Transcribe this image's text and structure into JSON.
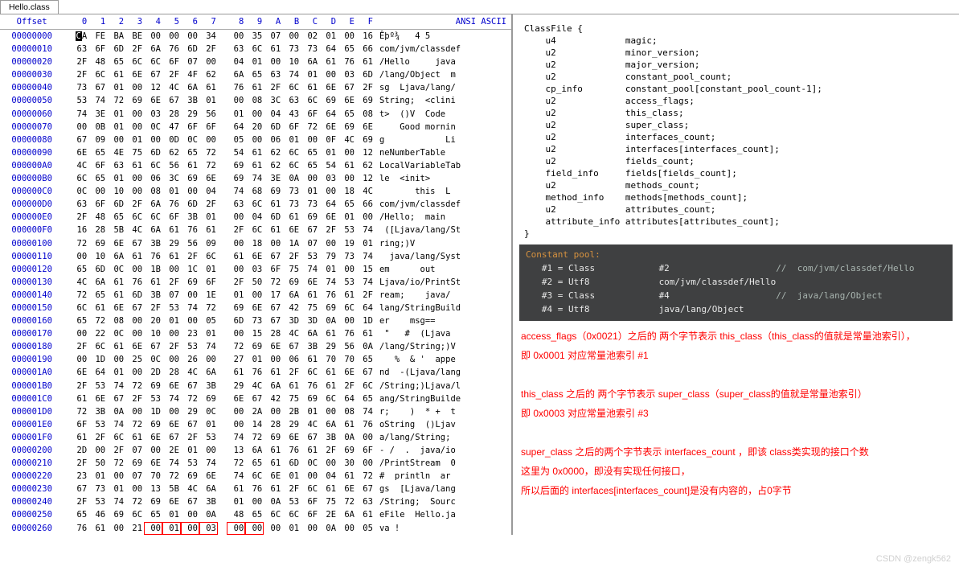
{
  "tab": "Hello.class",
  "headers": {
    "offset": "Offset",
    "hex": [
      "0",
      "1",
      "2",
      "3",
      "4",
      "5",
      "6",
      "7",
      "8",
      "9",
      "A",
      "B",
      "C",
      "D",
      "E",
      "F"
    ],
    "ascii": "ANSI ASCII"
  },
  "rows": [
    {
      "o": "00000000",
      "h": [
        "CA",
        "FE",
        "BA",
        "BE",
        "00",
        "00",
        "00",
        "34",
        "00",
        "35",
        "07",
        "00",
        "02",
        "01",
        "00",
        "16"
      ],
      "a": "Êþº¾   4 5    "
    },
    {
      "o": "00000010",
      "h": [
        "63",
        "6F",
        "6D",
        "2F",
        "6A",
        "76",
        "6D",
        "2F",
        "63",
        "6C",
        "61",
        "73",
        "73",
        "64",
        "65",
        "66"
      ],
      "a": "com/jvm/classdef"
    },
    {
      "o": "00000020",
      "h": [
        "2F",
        "48",
        "65",
        "6C",
        "6C",
        "6F",
        "07",
        "00",
        "04",
        "01",
        "00",
        "10",
        "6A",
        "61",
        "76",
        "61"
      ],
      "a": "/Hello     java"
    },
    {
      "o": "00000030",
      "h": [
        "2F",
        "6C",
        "61",
        "6E",
        "67",
        "2F",
        "4F",
        "62",
        "6A",
        "65",
        "63",
        "74",
        "01",
        "00",
        "03",
        "6D"
      ],
      "a": "/lang/Object  m"
    },
    {
      "o": "00000040",
      "h": [
        "73",
        "67",
        "01",
        "00",
        "12",
        "4C",
        "6A",
        "61",
        "76",
        "61",
        "2F",
        "6C",
        "61",
        "6E",
        "67",
        "2F"
      ],
      "a": "sg  Ljava/lang/"
    },
    {
      "o": "00000050",
      "h": [
        "53",
        "74",
        "72",
        "69",
        "6E",
        "67",
        "3B",
        "01",
        "00",
        "08",
        "3C",
        "63",
        "6C",
        "69",
        "6E",
        "69"
      ],
      "a": "String;  <clini"
    },
    {
      "o": "00000060",
      "h": [
        "74",
        "3E",
        "01",
        "00",
        "03",
        "28",
        "29",
        "56",
        "01",
        "00",
        "04",
        "43",
        "6F",
        "64",
        "65",
        "08"
      ],
      "a": "t>  ()V  Code "
    },
    {
      "o": "00000070",
      "h": [
        "00",
        "0B",
        "01",
        "00",
        "0C",
        "47",
        "6F",
        "6F",
        "64",
        "20",
        "6D",
        "6F",
        "72",
        "6E",
        "69",
        "6E"
      ],
      "a": "    Good mornin"
    },
    {
      "o": "00000080",
      "h": [
        "67",
        "09",
        "00",
        "01",
        "00",
        "0D",
        "0C",
        "00",
        "05",
        "00",
        "06",
        "01",
        "00",
        "0F",
        "4C",
        "69"
      ],
      "a": "g            Li"
    },
    {
      "o": "00000090",
      "h": [
        "6E",
        "65",
        "4E",
        "75",
        "6D",
        "62",
        "65",
        "72",
        "54",
        "61",
        "62",
        "6C",
        "65",
        "01",
        "00",
        "12"
      ],
      "a": "neNumberTable   "
    },
    {
      "o": "000000A0",
      "h": [
        "4C",
        "6F",
        "63",
        "61",
        "6C",
        "56",
        "61",
        "72",
        "69",
        "61",
        "62",
        "6C",
        "65",
        "54",
        "61",
        "62"
      ],
      "a": "LocalVariableTab"
    },
    {
      "o": "000000B0",
      "h": [
        "6C",
        "65",
        "01",
        "00",
        "06",
        "3C",
        "69",
        "6E",
        "69",
        "74",
        "3E",
        "0A",
        "00",
        "03",
        "00",
        "12"
      ],
      "a": "le  <init>     "
    },
    {
      "o": "000000C0",
      "h": [
        "0C",
        "00",
        "10",
        "00",
        "08",
        "01",
        "00",
        "04",
        "74",
        "68",
        "69",
        "73",
        "01",
        "00",
        "18",
        "4C"
      ],
      "a": "       this  L"
    },
    {
      "o": "000000D0",
      "h": [
        "63",
        "6F",
        "6D",
        "2F",
        "6A",
        "76",
        "6D",
        "2F",
        "63",
        "6C",
        "61",
        "73",
        "73",
        "64",
        "65",
        "66"
      ],
      "a": "com/jvm/classdef"
    },
    {
      "o": "000000E0",
      "h": [
        "2F",
        "48",
        "65",
        "6C",
        "6C",
        "6F",
        "3B",
        "01",
        "00",
        "04",
        "6D",
        "61",
        "69",
        "6E",
        "01",
        "00"
      ],
      "a": "/Hello;  main  "
    },
    {
      "o": "000000F0",
      "h": [
        "16",
        "28",
        "5B",
        "4C",
        "6A",
        "61",
        "76",
        "61",
        "2F",
        "6C",
        "61",
        "6E",
        "67",
        "2F",
        "53",
        "74"
      ],
      "a": " ([Ljava/lang/St"
    },
    {
      "o": "00000100",
      "h": [
        "72",
        "69",
        "6E",
        "67",
        "3B",
        "29",
        "56",
        "09",
        "00",
        "18",
        "00",
        "1A",
        "07",
        "00",
        "19",
        "01"
      ],
      "a": "ring;)V        "
    },
    {
      "o": "00000110",
      "h": [
        "00",
        "10",
        "6A",
        "61",
        "76",
        "61",
        "2F",
        "6C",
        "61",
        "6E",
        "67",
        "2F",
        "53",
        "79",
        "73",
        "74"
      ],
      "a": "  java/lang/Syst"
    },
    {
      "o": "00000120",
      "h": [
        "65",
        "6D",
        "0C",
        "00",
        "1B",
        "00",
        "1C",
        "01",
        "00",
        "03",
        "6F",
        "75",
        "74",
        "01",
        "00",
        "15"
      ],
      "a": "em      out   "
    },
    {
      "o": "00000130",
      "h": [
        "4C",
        "6A",
        "61",
        "76",
        "61",
        "2F",
        "69",
        "6F",
        "2F",
        "50",
        "72",
        "69",
        "6E",
        "74",
        "53",
        "74"
      ],
      "a": "Ljava/io/PrintSt"
    },
    {
      "o": "00000140",
      "h": [
        "72",
        "65",
        "61",
        "6D",
        "3B",
        "07",
        "00",
        "1E",
        "01",
        "00",
        "17",
        "6A",
        "61",
        "76",
        "61",
        "2F"
      ],
      "a": "ream;    java/"
    },
    {
      "o": "00000150",
      "h": [
        "6C",
        "61",
        "6E",
        "67",
        "2F",
        "53",
        "74",
        "72",
        "69",
        "6E",
        "67",
        "42",
        "75",
        "69",
        "6C",
        "64"
      ],
      "a": "lang/StringBuild"
    },
    {
      "o": "00000160",
      "h": [
        "65",
        "72",
        "08",
        "00",
        "20",
        "01",
        "00",
        "05",
        "6D",
        "73",
        "67",
        "3D",
        "3D",
        "0A",
        "00",
        "1D"
      ],
      "a": "er    msg==   "
    },
    {
      "o": "00000170",
      "h": [
        "00",
        "22",
        "0C",
        "00",
        "10",
        "00",
        "23",
        "01",
        "00",
        "15",
        "28",
        "4C",
        "6A",
        "61",
        "76",
        "61"
      ],
      "a": " \"   #  (Ljava"
    },
    {
      "o": "00000180",
      "h": [
        "2F",
        "6C",
        "61",
        "6E",
        "67",
        "2F",
        "53",
        "74",
        "72",
        "69",
        "6E",
        "67",
        "3B",
        "29",
        "56",
        "0A"
      ],
      "a": "/lang/String;)V "
    },
    {
      "o": "00000190",
      "h": [
        "00",
        "1D",
        "00",
        "25",
        "0C",
        "00",
        "26",
        "00",
        "27",
        "01",
        "00",
        "06",
        "61",
        "70",
        "70",
        "65"
      ],
      "a": "   %  & '  appe"
    },
    {
      "o": "000001A0",
      "h": [
        "6E",
        "64",
        "01",
        "00",
        "2D",
        "28",
        "4C",
        "6A",
        "61",
        "76",
        "61",
        "2F",
        "6C",
        "61",
        "6E",
        "67"
      ],
      "a": "nd  -(Ljava/lang"
    },
    {
      "o": "000001B0",
      "h": [
        "2F",
        "53",
        "74",
        "72",
        "69",
        "6E",
        "67",
        "3B",
        "29",
        "4C",
        "6A",
        "61",
        "76",
        "61",
        "2F",
        "6C"
      ],
      "a": "/String;)Ljava/l"
    },
    {
      "o": "000001C0",
      "h": [
        "61",
        "6E",
        "67",
        "2F",
        "53",
        "74",
        "72",
        "69",
        "6E",
        "67",
        "42",
        "75",
        "69",
        "6C",
        "64",
        "65"
      ],
      "a": "ang/StringBuilde"
    },
    {
      "o": "000001D0",
      "h": [
        "72",
        "3B",
        "0A",
        "00",
        "1D",
        "00",
        "29",
        "0C",
        "00",
        "2A",
        "00",
        "2B",
        "01",
        "00",
        "08",
        "74"
      ],
      "a": "r;    )  * +  t"
    },
    {
      "o": "000001E0",
      "h": [
        "6F",
        "53",
        "74",
        "72",
        "69",
        "6E",
        "67",
        "01",
        "00",
        "14",
        "28",
        "29",
        "4C",
        "6A",
        "61",
        "76"
      ],
      "a": "oString  ()Ljav"
    },
    {
      "o": "000001F0",
      "h": [
        "61",
        "2F",
        "6C",
        "61",
        "6E",
        "67",
        "2F",
        "53",
        "74",
        "72",
        "69",
        "6E",
        "67",
        "3B",
        "0A",
        "00"
      ],
      "a": "a/lang/String;  "
    },
    {
      "o": "00000200",
      "h": [
        "2D",
        "00",
        "2F",
        "07",
        "00",
        "2E",
        "01",
        "00",
        "13",
        "6A",
        "61",
        "76",
        "61",
        "2F",
        "69",
        "6F"
      ],
      "a": "- /  .  java/io"
    },
    {
      "o": "00000210",
      "h": [
        "2F",
        "50",
        "72",
        "69",
        "6E",
        "74",
        "53",
        "74",
        "72",
        "65",
        "61",
        "6D",
        "0C",
        "00",
        "30",
        "00"
      ],
      "a": "/PrintStream  0 "
    },
    {
      "o": "00000220",
      "h": [
        "23",
        "01",
        "00",
        "07",
        "70",
        "72",
        "69",
        "6E",
        "74",
        "6C",
        "6E",
        "01",
        "00",
        "04",
        "61",
        "72"
      ],
      "a": "#  println  ar"
    },
    {
      "o": "00000230",
      "h": [
        "67",
        "73",
        "01",
        "00",
        "13",
        "5B",
        "4C",
        "6A",
        "61",
        "76",
        "61",
        "2F",
        "6C",
        "61",
        "6E",
        "67"
      ],
      "a": "gs  [Ljava/lang"
    },
    {
      "o": "00000240",
      "h": [
        "2F",
        "53",
        "74",
        "72",
        "69",
        "6E",
        "67",
        "3B",
        "01",
        "00",
        "0A",
        "53",
        "6F",
        "75",
        "72",
        "63"
      ],
      "a": "/String;  Sourc"
    },
    {
      "o": "00000250",
      "h": [
        "65",
        "46",
        "69",
        "6C",
        "65",
        "01",
        "00",
        "0A",
        "48",
        "65",
        "6C",
        "6C",
        "6F",
        "2E",
        "6A",
        "61"
      ],
      "a": "eFile  Hello.ja"
    },
    {
      "o": "00000260",
      "h": [
        "76",
        "61",
        "00",
        "21",
        "00",
        "01",
        "00",
        "03",
        "00",
        "00",
        "00",
        "01",
        "00",
        "0A",
        "00",
        "05"
      ],
      "a": "va !            "
    }
  ],
  "classfile": "ClassFile {\n    u4             magic;\n    u2             minor_version;\n    u2             major_version;\n    u2             constant_pool_count;\n    cp_info        constant_pool[constant_pool_count-1];\n    u2             access_flags;\n    u2             this_class;\n    u2             super_class;\n    u2             interfaces_count;\n    u2             interfaces[interfaces_count];\n    u2             fields_count;\n    field_info     fields[fields_count];\n    u2             methods_count;\n    method_info    methods[methods_count];\n    u2             attributes_count;\n    attribute_info attributes[attributes_count];\n}",
  "pool": {
    "title": "Constant pool:",
    "rows": [
      {
        "l": "   #1 = Class",
        "m": "#2",
        "c": "//  com/jvm/classdef/Hello"
      },
      {
        "l": "   #2 = Utf8",
        "m": "com/jvm/classdef/Hello",
        "c": ""
      },
      {
        "l": "   #3 = Class",
        "m": "#4",
        "c": "//  java/lang/Object"
      },
      {
        "l": "   #4 = Utf8",
        "m": "java/lang/Object",
        "c": ""
      }
    ]
  },
  "notes": [
    "access_flags（0x0021）之后的 两个字节表示 this_class（this_class的值就是常量池索引），",
    "即 0x0001 对应常量池索引 #1",
    "",
    "this_class 之后的 两个字节表示 super_class（super_class的值就是常量池索引）",
    "即 0x0003 对应常量池索引 #3",
    "",
    "super_class 之后的两个字节表示 interfaces_count ，即该 class类实现的接口个数",
    "这里为 0x0000，即没有实现任何接口，",
    "所以后面的 interfaces[interfaces_count]是没有内容的，占0字节"
  ],
  "watermark": "CSDN @zengk562"
}
